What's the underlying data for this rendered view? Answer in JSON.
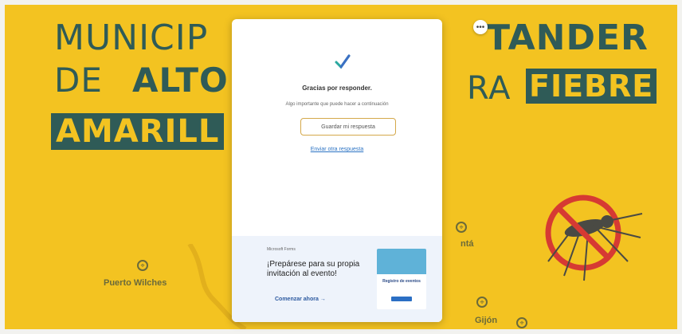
{
  "banner": {
    "headline_line1_left": "MUNICIP",
    "headline_line1_right": "TANDER",
    "headline_line2_left_a": "DE",
    "headline_line2_left_b": "ALTO",
    "headline_line2_right_a": "RA",
    "headline_line2_right_b": "FIEBRE",
    "headline_line3": "AMARILL",
    "places": {
      "puerto_wilches": "Puerto Wilches",
      "gijon": "Gijón",
      "right_partial": "ntá"
    },
    "colors": {
      "background": "#f3c321",
      "text": "#2f5b57"
    }
  },
  "dialog": {
    "more_icon": "ellipsis-icon",
    "check_icon": "checkmark-icon",
    "title": "Gracias por responder.",
    "subtitle": "Algo importante que puede hacer a continuación",
    "save_button": "Guardar mi respuesta",
    "another_link": "Enviar otra respuesta"
  },
  "promo": {
    "brand": "Microsoft Forms",
    "title": "¡Prepárese para su propia invitación al evento!",
    "cta": "Comenzar ahora",
    "cta_icon": "arrow-right-icon",
    "image_label": "Registro de eventos"
  }
}
